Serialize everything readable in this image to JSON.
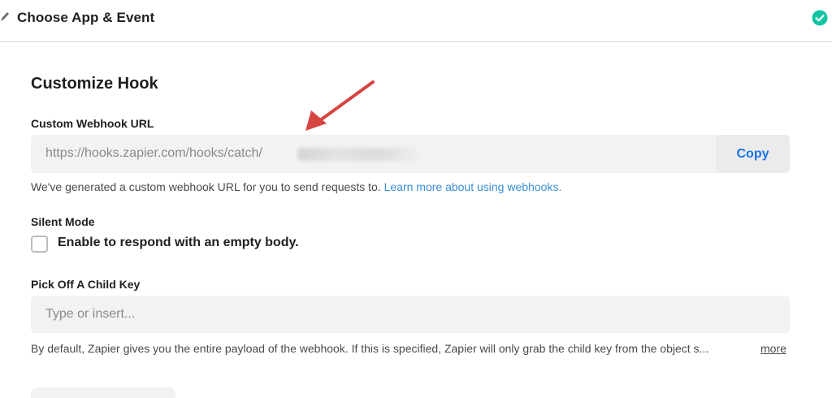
{
  "header": {
    "title": "Choose App & Event",
    "status_color": "#13c4a3"
  },
  "section": {
    "title": "Customize Hook"
  },
  "webhook_url": {
    "label": "Custom Webhook URL",
    "value": "https://hooks.zapier.com/hooks/catch/",
    "copy_label": "Copy",
    "help_text": "We've generated a custom webhook URL for you to send requests to. ",
    "help_link": "Learn more about using webhooks."
  },
  "silent_mode": {
    "label": "Silent Mode",
    "checkbox_label": "Enable to respond with an empty body.",
    "checked": false
  },
  "child_key": {
    "label": "Pick Off A Child Key",
    "placeholder": "Type or insert...",
    "help_text": "By default, Zapier gives you the entire payload of the webhook. If this is specified, Zapier will only grab the child key from the object s...",
    "more_label": "more"
  },
  "annotation": {
    "arrow_color": "#d64541"
  }
}
